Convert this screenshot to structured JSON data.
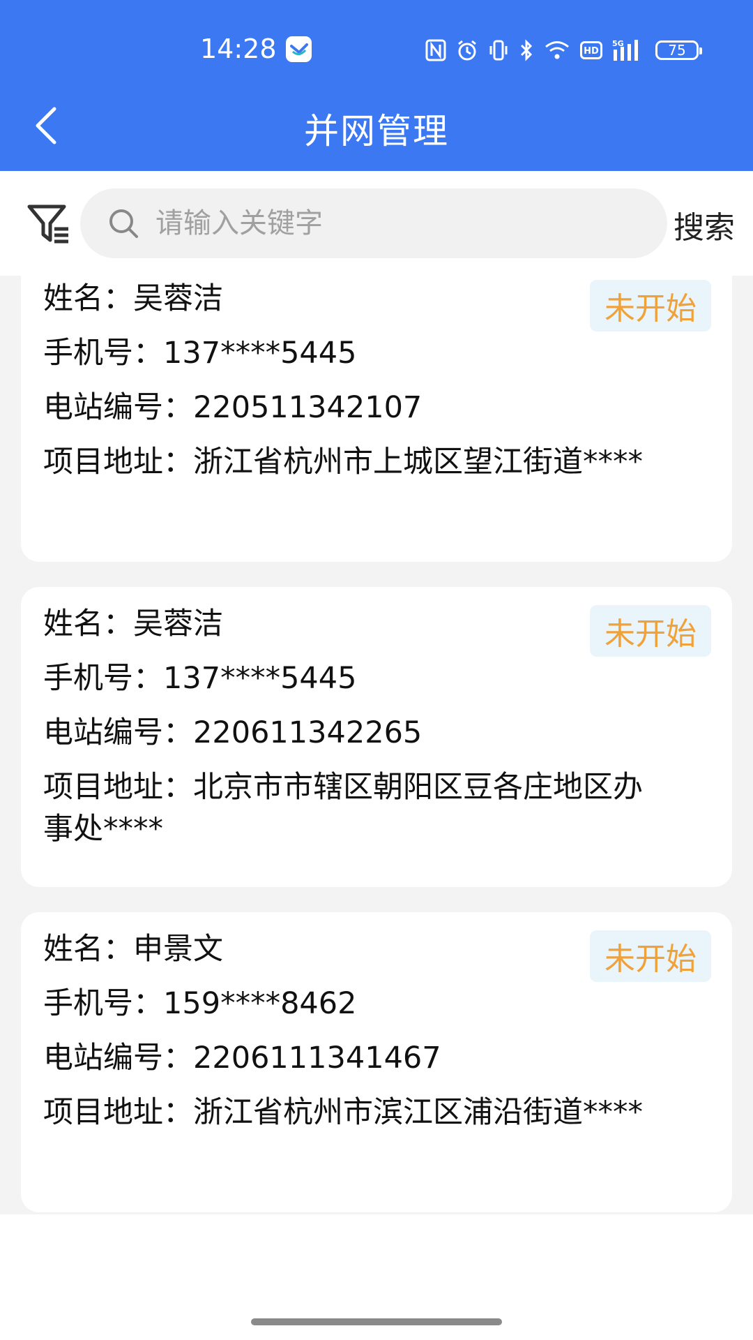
{
  "status_bar": {
    "time": "14:28",
    "battery": "75",
    "icons": [
      "nfc-icon",
      "alarm-icon",
      "vibrate-icon",
      "bluetooth-icon",
      "wifi-icon",
      "hd-icon",
      "signal-5g-icon",
      "battery-icon"
    ]
  },
  "header": {
    "title": "并网管理",
    "back_icon": "chevron-left-icon",
    "background": "#3b78f2"
  },
  "search": {
    "placeholder": "请输入关键字",
    "button_label": "搜索",
    "filter_icon": "filter-icon"
  },
  "labels": {
    "name": "姓名：",
    "phone": "手机号：",
    "station": "电站编号：",
    "address": "项目地址："
  },
  "colors": {
    "badge_text": "#f0a23a",
    "badge_bg": "#e9f4fb",
    "list_bg": "#f3f3f3"
  },
  "records": [
    {
      "name": "吴蓉洁",
      "phone": "137****5445",
      "station_no": "220511342107",
      "address": "浙江省杭州市上城区望江街道****",
      "status": "未开始"
    },
    {
      "name": "吴蓉洁",
      "phone": "137****5445",
      "station_no": "220611342265",
      "address": "北京市市辖区朝阳区豆各庄地区办事处****",
      "status": "未开始"
    },
    {
      "name": "申景文",
      "phone": "159****8462",
      "station_no": "2206111341467",
      "address": "浙江省杭州市滨江区浦沿街道****",
      "status": "未开始"
    }
  ]
}
